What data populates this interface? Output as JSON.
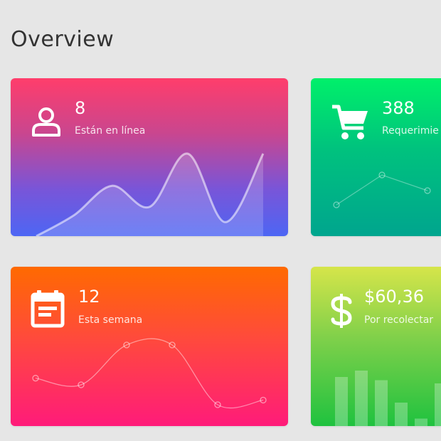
{
  "page": {
    "title": "Overview"
  },
  "cards": {
    "users": {
      "value": "8",
      "label": "Están en línea",
      "icon": "user-icon"
    },
    "orders": {
      "value": "388",
      "label": "Requerimie",
      "icon": "shopping-cart-icon"
    },
    "week": {
      "value": "12",
      "label": "Esta semana",
      "icon": "calendar-icon"
    },
    "money": {
      "value": "$60,36",
      "label": "Por recolectar",
      "icon": "dollar-icon"
    }
  },
  "chart_data": [
    {
      "type": "area",
      "values": [
        0,
        30,
        72,
        42,
        118,
        20,
        118
      ]
    },
    {
      "type": "line",
      "values": [
        30,
        72,
        50
      ]
    },
    {
      "type": "line",
      "values": [
        55,
        45,
        105,
        105,
        15,
        22
      ]
    },
    {
      "type": "bar",
      "values": [
        90,
        100,
        85,
        50,
        25,
        80
      ]
    }
  ]
}
